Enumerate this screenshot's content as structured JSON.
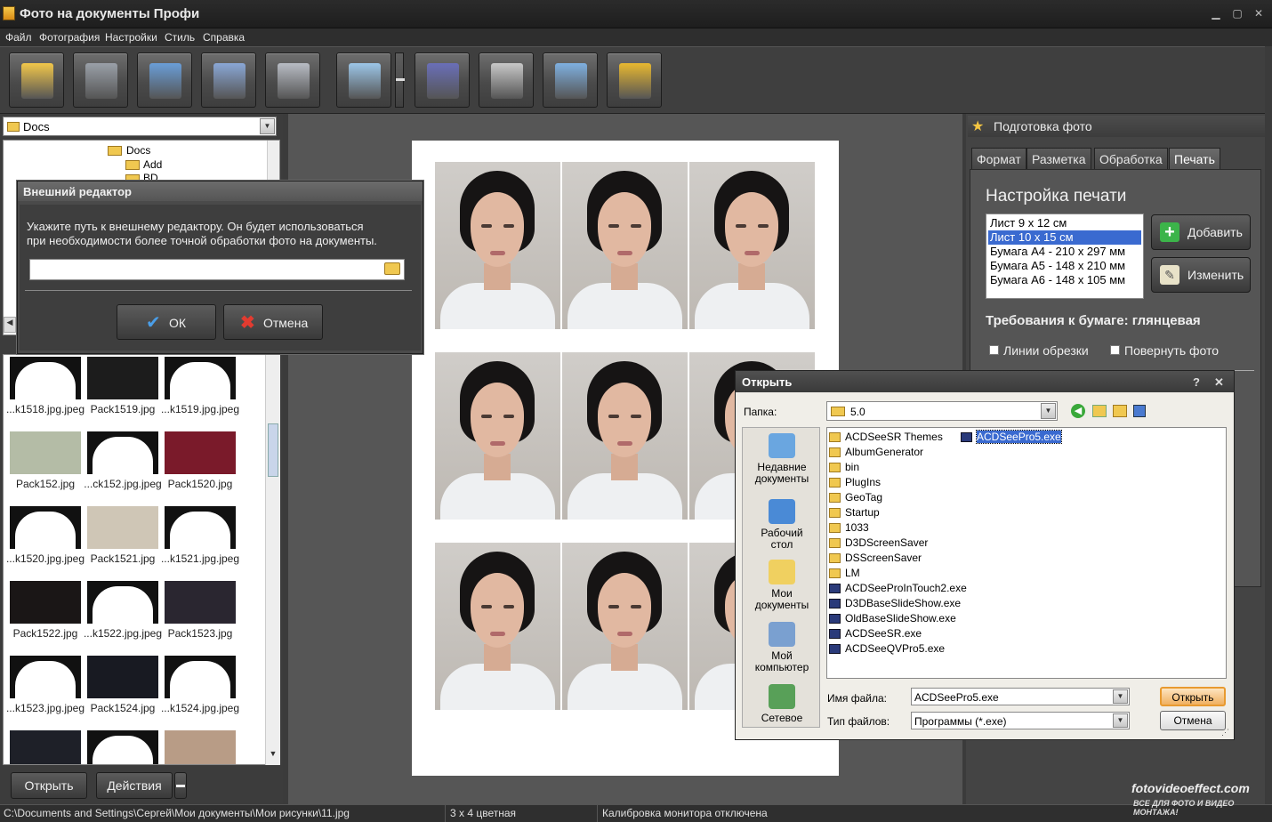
{
  "window": {
    "title": "Фото на документы Профи"
  },
  "menu": [
    "Файл",
    "Фотография",
    "Настройки",
    "Стиль",
    "Справка"
  ],
  "toolbar": [
    {
      "name": "open-folder-icon",
      "color": "#f2c74a"
    },
    {
      "name": "save-disk-icon",
      "color": "#9aa0a8"
    },
    {
      "name": "user-search-icon",
      "color": "#6a9ed8"
    },
    {
      "name": "printer-icon",
      "color": "#8aa7d6"
    },
    {
      "name": "camera-icon",
      "color": "#b8bcc4"
    },
    {
      "name": "zoom-image-icon",
      "color": "#9cc6e8"
    },
    {
      "name": "help-book-icon",
      "color": "#6a6fb8"
    },
    {
      "name": "film-reel-icon",
      "color": "#c8c8c8"
    },
    {
      "name": "home-icon",
      "color": "#7fb0e0"
    },
    {
      "name": "shopping-cart-icon",
      "color": "#e8b830"
    }
  ],
  "left": {
    "folder": "Docs",
    "tree": [
      "Docs",
      "Add",
      "BD"
    ],
    "thumbs": [
      {
        "label": "...k1518.jpg.jpeg",
        "color": "#ffffff"
      },
      {
        "label": "Pack1519.jpg",
        "color": "#1c1c1c"
      },
      {
        "label": "...k1519.jpg.jpeg",
        "color": "#ffffff"
      },
      {
        "label": "Pack152.jpg",
        "color": "#b4bca6"
      },
      {
        "label": "...ck152.jpg.jpeg",
        "color": "#ffffff"
      },
      {
        "label": "Pack1520.jpg",
        "color": "#7a1a2a"
      },
      {
        "label": "...k1520.jpg.jpeg",
        "color": "#ffffff"
      },
      {
        "label": "Pack1521.jpg",
        "color": "#cfc6b6"
      },
      {
        "label": "...k1521.jpg.jpeg",
        "color": "#ffffff"
      },
      {
        "label": "Pack1522.jpg",
        "color": "#1a1616"
      },
      {
        "label": "...k1522.jpg.jpeg",
        "color": "#ffffff"
      },
      {
        "label": "Pack1523.jpg",
        "color": "#2a2630"
      },
      {
        "label": "...k1523.jpg.jpeg",
        "color": "#ffffff"
      },
      {
        "label": "Pack1524.jpg",
        "color": "#181a22"
      },
      {
        "label": "...k1524.jpg.jpeg",
        "color": "#ffffff"
      },
      {
        "label": "",
        "color": "#1e2028"
      },
      {
        "label": "",
        "color": "#ffffff"
      },
      {
        "label": "",
        "color": "#b89c86"
      }
    ],
    "btn_open": "Открыть",
    "btn_actions": "Действия"
  },
  "status": {
    "path": "C:\\Documents and Settings\\Сергей\\Мои документы\\Мои рисунки\\11.jpg",
    "format": "3 x 4 цветная",
    "calibration": "Калибровка монитора отключена"
  },
  "right": {
    "header": "Подготовка фото",
    "tabs": [
      "Формат",
      "Разметка",
      "Обработка",
      "Печать"
    ],
    "active_tab": "Печать",
    "print_title": "Настройка печати",
    "sizes": [
      "Лист 9 x 12 см",
      "Лист 10 x 15 см",
      "Бумага А4 - 210 x 297 мм",
      "Бумага А5 - 148 x 210 мм",
      "Бумага А6 - 148 x 105 мм"
    ],
    "selected_size": "Лист 10 x 15 см",
    "btn_add": "Добавить",
    "btn_edit": "Изменить",
    "paper_req": "Требования к бумаге: глянцевая",
    "chk_cut": "Линии обрезки",
    "chk_rotate": "Повернуть фото"
  },
  "dialog_editor": {
    "title": "Внешний редактор",
    "message1": "Укажите путь к внешнему редактору. Он будет использоваться",
    "message2": "при необходимости более точной обработки фото на документы.",
    "path_value": "",
    "ok": "ОК",
    "cancel": "Отмена"
  },
  "dialog_open": {
    "title": "Открыть",
    "help": "?",
    "close": "✕",
    "folder_label": "Папка:",
    "folder": "5.0",
    "places": [
      "Недавние документы",
      "Рабочий стол",
      "Мои документы",
      "Мой компьютер",
      "Сетевое"
    ],
    "files_col1": [
      {
        "name": "ACDSeeSR Themes",
        "kind": "folder"
      },
      {
        "name": "AlbumGenerator",
        "kind": "folder"
      },
      {
        "name": "bin",
        "kind": "folder"
      },
      {
        "name": "PlugIns",
        "kind": "folder"
      },
      {
        "name": "GeoTag",
        "kind": "folder"
      },
      {
        "name": "Startup",
        "kind": "folder"
      },
      {
        "name": "1033",
        "kind": "folder"
      },
      {
        "name": "D3DScreenSaver",
        "kind": "folder"
      },
      {
        "name": "DSScreenSaver",
        "kind": "folder"
      },
      {
        "name": "LM",
        "kind": "folder"
      },
      {
        "name": "ACDSeeProInTouch2.exe",
        "kind": "exe"
      },
      {
        "name": "D3DBaseSlideShow.exe",
        "kind": "exe"
      },
      {
        "name": "OldBaseSlideShow.exe",
        "kind": "exe"
      },
      {
        "name": "ACDSeeSR.exe",
        "kind": "exe"
      },
      {
        "name": "ACDSeeQVPro5.exe",
        "kind": "exe"
      }
    ],
    "files_col2": [
      {
        "name": "ACDSeePro5.exe",
        "kind": "exe",
        "selected": true
      }
    ],
    "filename_label": "Имя файла:",
    "filename": "ACDSeePro5.exe",
    "filetype_label": "Тип файлов:",
    "filetype": "Программы (*.exe)",
    "btn_open": "Открыть",
    "btn_cancel": "Отмена"
  },
  "watermark": {
    "line1": "fotovideoeffect.com",
    "line2": "ВСЕ ДЛЯ ФОТО И ВИДЕО МОНТАЖА!"
  }
}
